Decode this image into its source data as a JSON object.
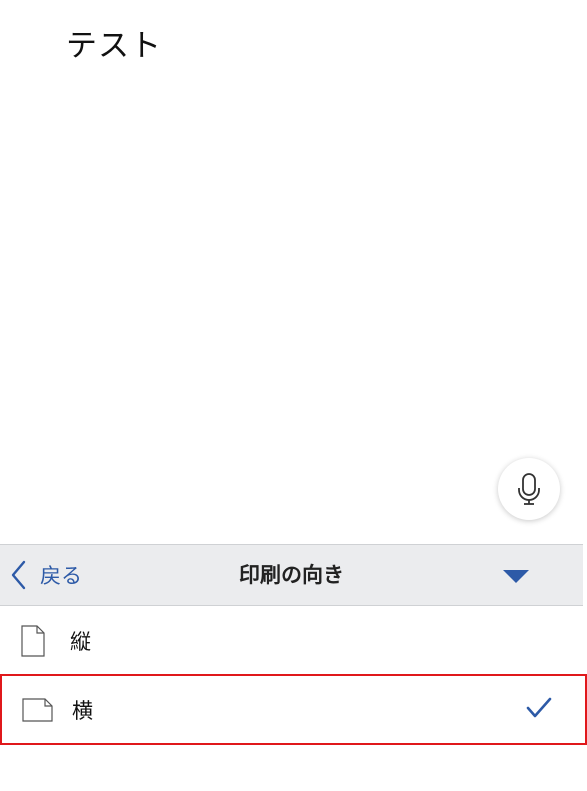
{
  "document": {
    "text": "テスト"
  },
  "panel": {
    "back_label": "戻る",
    "title": "印刷の向き"
  },
  "options": [
    {
      "label": "縦",
      "icon": "page-portrait-icon",
      "selected": false
    },
    {
      "label": "横",
      "icon": "page-landscape-icon",
      "selected": true
    }
  ],
  "colors": {
    "accent": "#2d5aa7",
    "highlight": "#e0181b",
    "header_bg": "#ebecee"
  }
}
